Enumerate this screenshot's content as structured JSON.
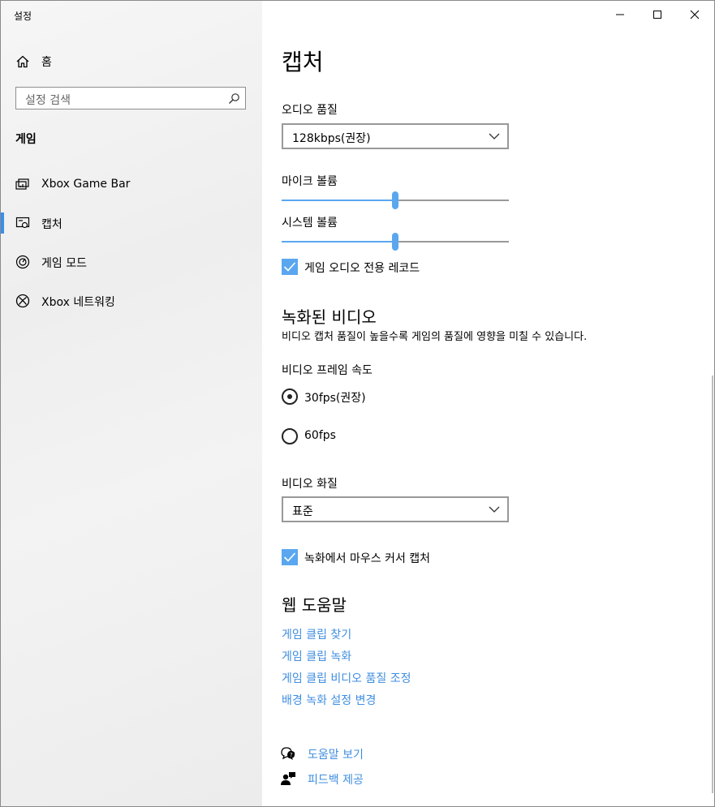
{
  "window": {
    "title": "설정",
    "controls": {
      "minimize": "minimize-icon",
      "maximize": "maximize-icon",
      "close": "close-icon"
    }
  },
  "sidebar": {
    "home_label": "홈",
    "search_placeholder": "설정 검색",
    "section_title": "게임",
    "items": [
      {
        "label": "Xbox Game Bar",
        "icon": "game-bar-icon",
        "selected": false
      },
      {
        "label": "캡처",
        "icon": "capture-icon",
        "selected": true
      },
      {
        "label": "게임 모드",
        "icon": "game-mode-icon",
        "selected": false
      },
      {
        "label": "Xbox 네트워킹",
        "icon": "xbox-icon",
        "selected": false
      }
    ]
  },
  "main": {
    "title": "캡처",
    "audio_quality": {
      "label": "오디오 품질",
      "value": "128kbps(권장)"
    },
    "mic_volume": {
      "label": "마이크 볼륨",
      "level_percent": 50
    },
    "system_volume": {
      "label": "시스템 볼륨",
      "level_percent": 50
    },
    "game_audio_only": {
      "label": "게임 오디오 전용 레코드",
      "checked": true
    },
    "recorded_video": {
      "heading": "녹화된 비디오",
      "description": "비디오 캡처 품질이 높을수록 게임의 품질에 영향을 미칠 수 있습니다."
    },
    "frame_rate": {
      "label": "비디오 프레임 속도",
      "options": [
        {
          "label": "30fps(권장)",
          "selected": true
        },
        {
          "label": "60fps",
          "selected": false
        }
      ]
    },
    "video_quality": {
      "label": "비디오 화질",
      "value": "표준"
    },
    "capture_cursor": {
      "label": "녹화에서 마우스 커서 캡처",
      "checked": true
    },
    "web_help": {
      "heading": "웹 도움말",
      "links": [
        "게임 클립 찾기",
        "게임 클립 녹화",
        "게임 클립 비디오 품질 조정",
        "배경 녹화 설정 변경"
      ]
    },
    "footer": {
      "get_help": "도움말 보기",
      "feedback": "피드백 제공"
    }
  },
  "colors": {
    "accent": "#5aa7f0",
    "link": "#3f8ee0",
    "selection_bar": "#3b8eea"
  }
}
